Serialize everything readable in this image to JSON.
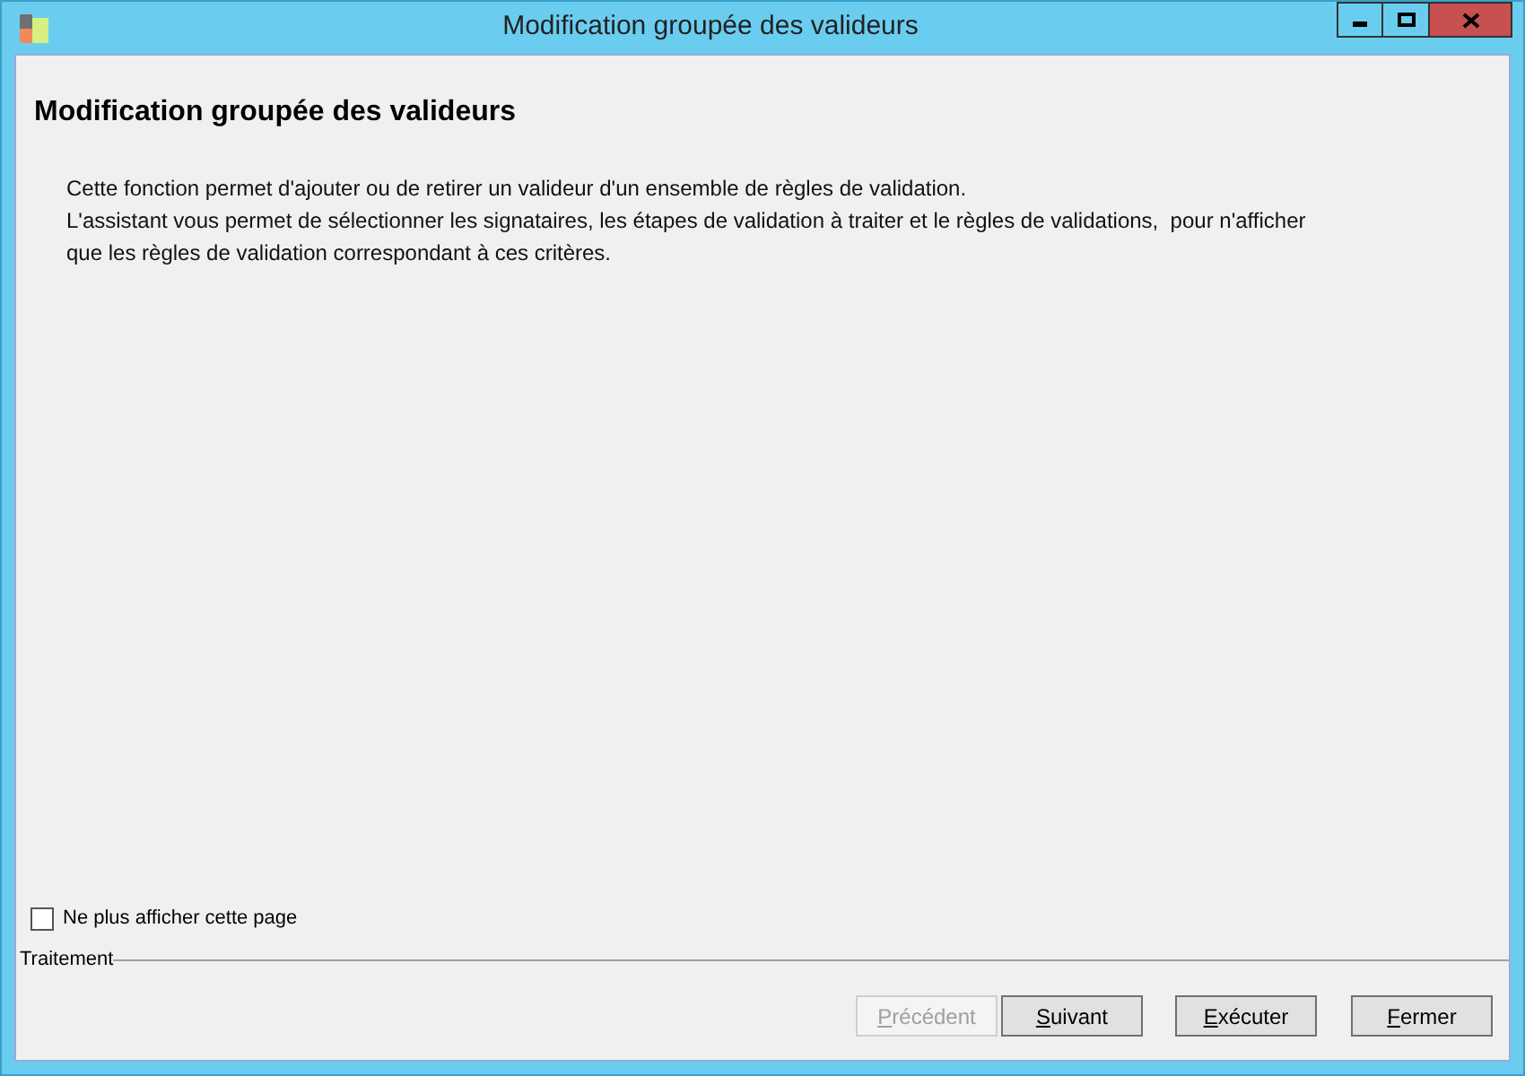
{
  "window": {
    "title": "Modification groupée des valideurs"
  },
  "page": {
    "heading": "Modification groupée des valideurs",
    "description_lines": [
      "Cette fonction permet d'ajouter ou de retirer un valideur d'un ensemble de règles de validation.",
      "L'assistant vous permet de sélectionner les signataires, les étapes de validation à traiter et le règles de validations,  pour n'afficher",
      "que les règles de validation correspondant à ces critères."
    ]
  },
  "dont_show_again": {
    "label": "Ne plus afficher cette page",
    "checked": false
  },
  "group_label": "Traitement",
  "buttons": [
    {
      "accel": "P",
      "rest": "récédent",
      "disabled": true
    },
    {
      "accel": "S",
      "rest": "uivant",
      "disabled": false
    },
    {
      "accel": "E",
      "rest": "xécuter",
      "disabled": false
    },
    {
      "accel": "F",
      "rest": "ermer",
      "disabled": false
    }
  ]
}
